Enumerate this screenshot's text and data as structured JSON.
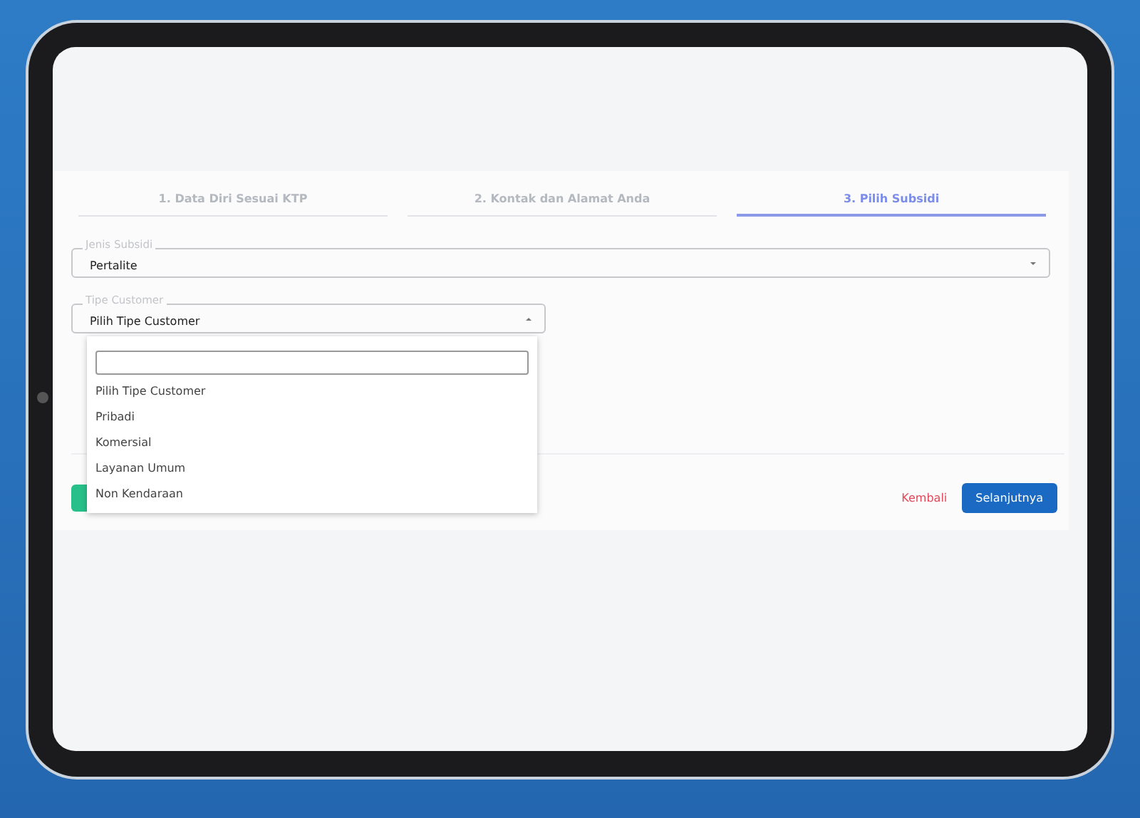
{
  "steps": [
    {
      "label": "1.  Data Diri Sesuai KTP",
      "selected": false
    },
    {
      "label": "2.  Kontak dan Alamat Anda",
      "selected": false
    },
    {
      "label": "3.  Pilih Subsidi",
      "selected": true
    }
  ],
  "fields": [
    {
      "label": "Jenis Subsidi",
      "value": "Pertalite",
      "expanded": false
    },
    {
      "label": "Tipe Customer",
      "value": "Pilih Tipe Customer",
      "expanded": true
    }
  ],
  "dropdown": {
    "options": [
      {
        "label": "Pilih Tipe Customer"
      },
      {
        "label": "Pribadi"
      },
      {
        "label": "Komersial"
      },
      {
        "label": "Layanan Umum"
      },
      {
        "label": "Non Kendaraan"
      }
    ]
  },
  "actions": {
    "back": "Kembali",
    "next": "Selanjutnya"
  }
}
